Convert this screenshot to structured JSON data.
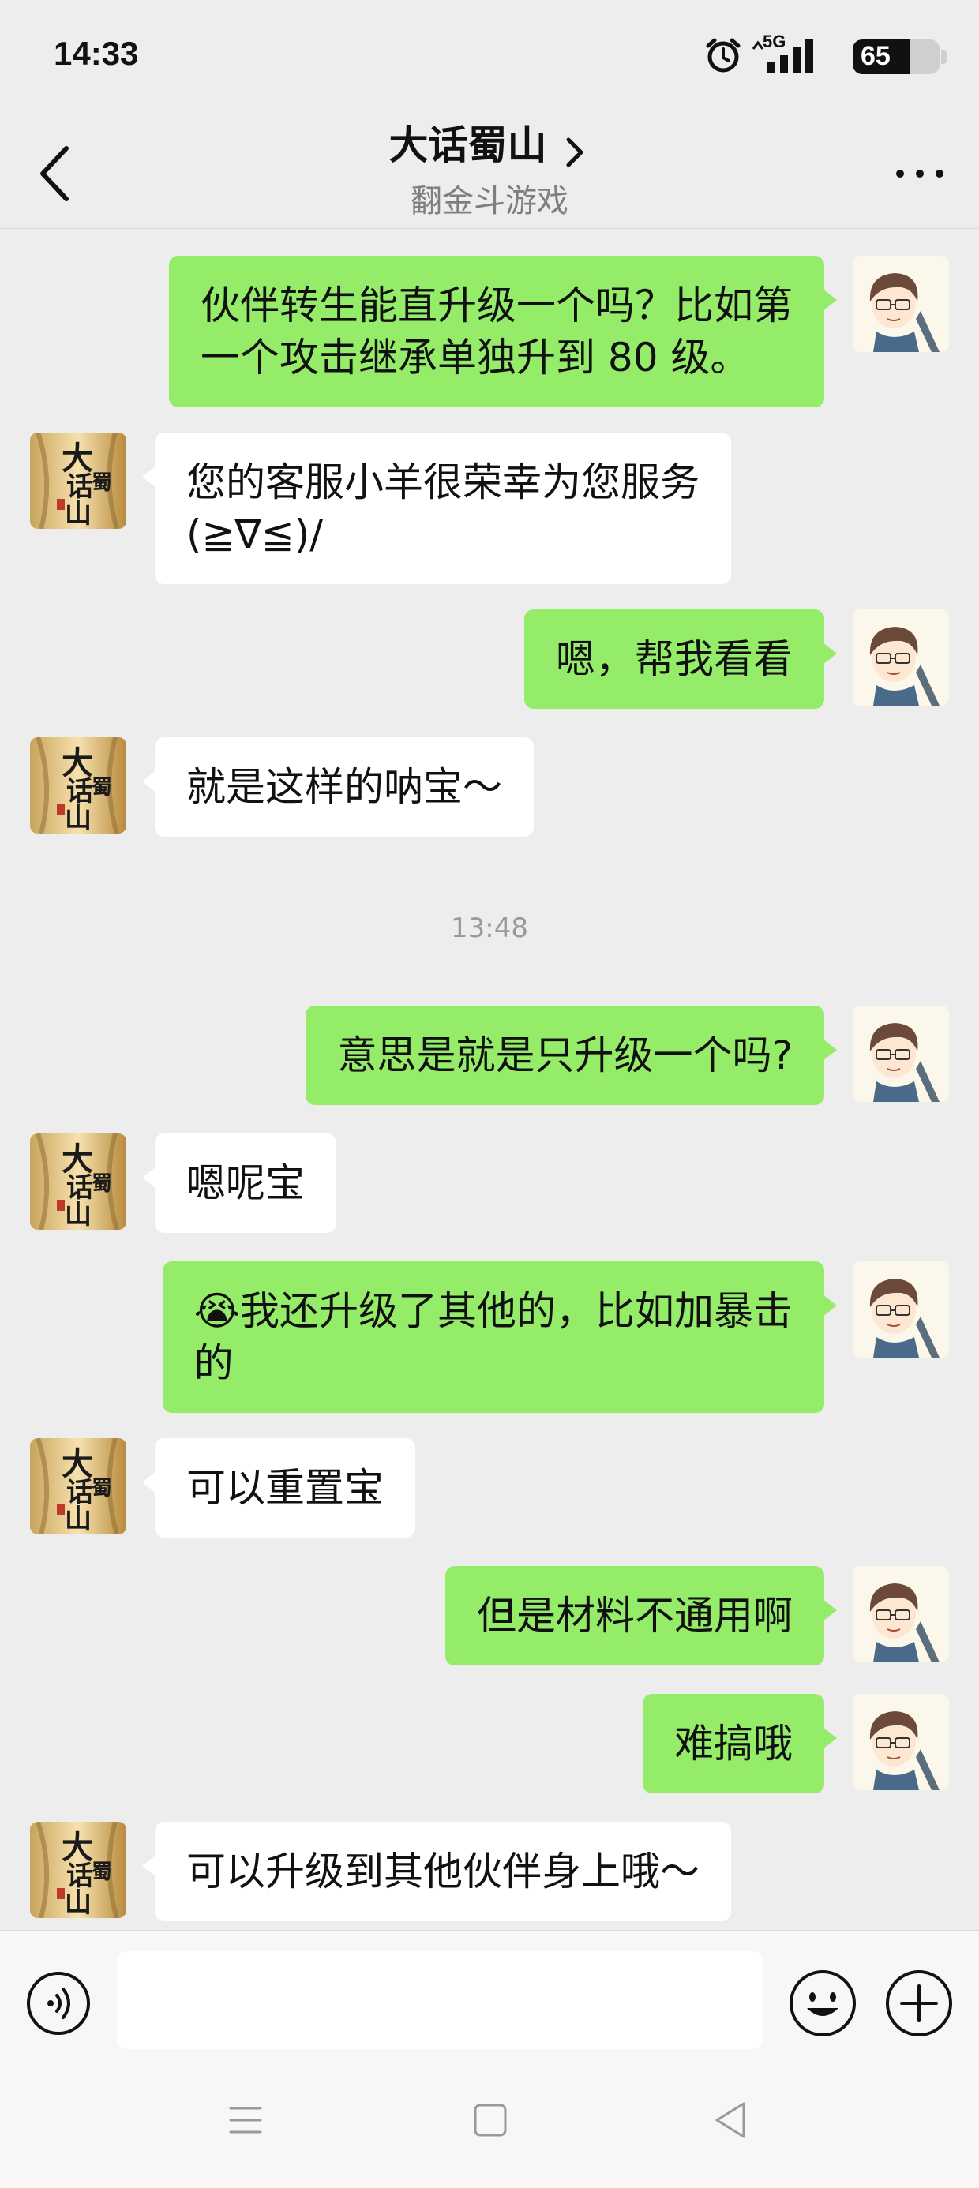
{
  "status_bar": {
    "time": "14:33",
    "network": "5G",
    "battery": "65",
    "battery_level_percent": 65
  },
  "header": {
    "title": "大话蜀山",
    "subtitle": "翻金斗游戏"
  },
  "messages": [
    {
      "sender": "me",
      "text": "伙伴转生能直升级一个吗？比如第\n一个攻击继承单独升到 80 级。"
    },
    {
      "sender": "them",
      "text": "您的客服小羊很荣幸为您服务\n(≧∇≦)/"
    },
    {
      "sender": "me",
      "text": "嗯，帮我看看"
    },
    {
      "sender": "them",
      "text": "就是这样的呐宝～"
    },
    {
      "timestamp": "13:48"
    },
    {
      "sender": "me",
      "text": "意思是就是只升级一个吗?"
    },
    {
      "sender": "them",
      "text": "嗯呢宝"
    },
    {
      "sender": "me",
      "text": "😭我还升级了其他的，比如加暴击\n的"
    },
    {
      "sender": "them",
      "text": "可以重置宝"
    },
    {
      "sender": "me",
      "text": "但是材料不通用啊"
    },
    {
      "sender": "me",
      "text": "难搞哦"
    },
    {
      "sender": "them",
      "text": "可以升级到其他伙伴身上哦～"
    }
  ],
  "contact_avatar_text": "大话蜀山",
  "colors": {
    "background": "#ededed",
    "my_bubble": "#95ec69",
    "their_bubble": "#ffffff",
    "timestamp": "#9a9a9a"
  },
  "icons": {
    "back": "chevron-left-icon",
    "title_arrow": "chevron-right-icon",
    "more": "more-dots-icon",
    "voice": "voice-icon",
    "emoji": "emoji-icon",
    "plus": "plus-icon"
  }
}
